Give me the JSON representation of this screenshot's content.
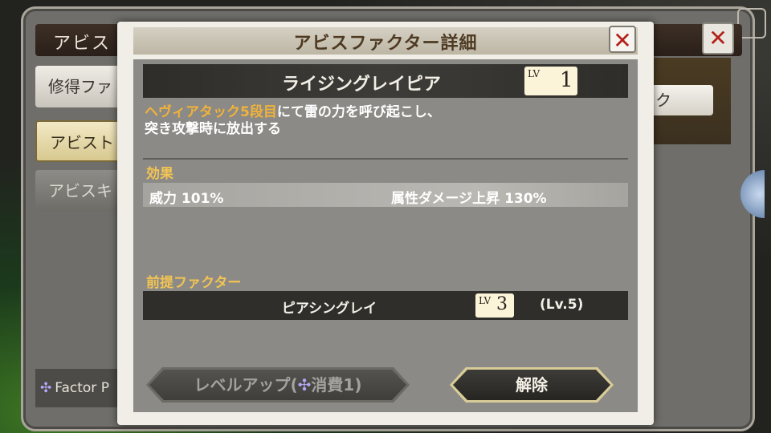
{
  "background": {
    "panel_title": "アビス",
    "tabs": [
      {
        "label": "修得ファ"
      },
      {
        "label": "アビスト"
      },
      {
        "label": "アビスキ"
      }
    ],
    "right_button": "ク",
    "footer_label": "Factor P",
    "footer_icon": "factor-point-icon"
  },
  "dialog": {
    "title": "アビスファクター詳細",
    "close_icon": "close-x-icon",
    "factor": {
      "name": "ライジングレイピア",
      "lv_prefix": "LV",
      "level": "1"
    },
    "description": {
      "highlight": "ヘヴィアタック5段目",
      "line1_rest": "にて雷の力を呼び起こし、",
      "line2": "突き攻撃時に放出する"
    },
    "effect": {
      "label": "効果",
      "power": "威力 101%",
      "element_damage": "属性ダメージ上昇 130%"
    },
    "prerequisite": {
      "label": "前提ファクター",
      "name": "ピアシングレイ",
      "lv_prefix": "LV",
      "level": "3",
      "required": "(Lv.5)"
    },
    "buttons": {
      "level_up_prefix": "レベルアップ(",
      "level_up_suffix": "消費1)",
      "release": "解除"
    }
  },
  "colors": {
    "highlight": "#f0b23a",
    "section_label": "#f2c453",
    "close_x": "#b4211b"
  }
}
